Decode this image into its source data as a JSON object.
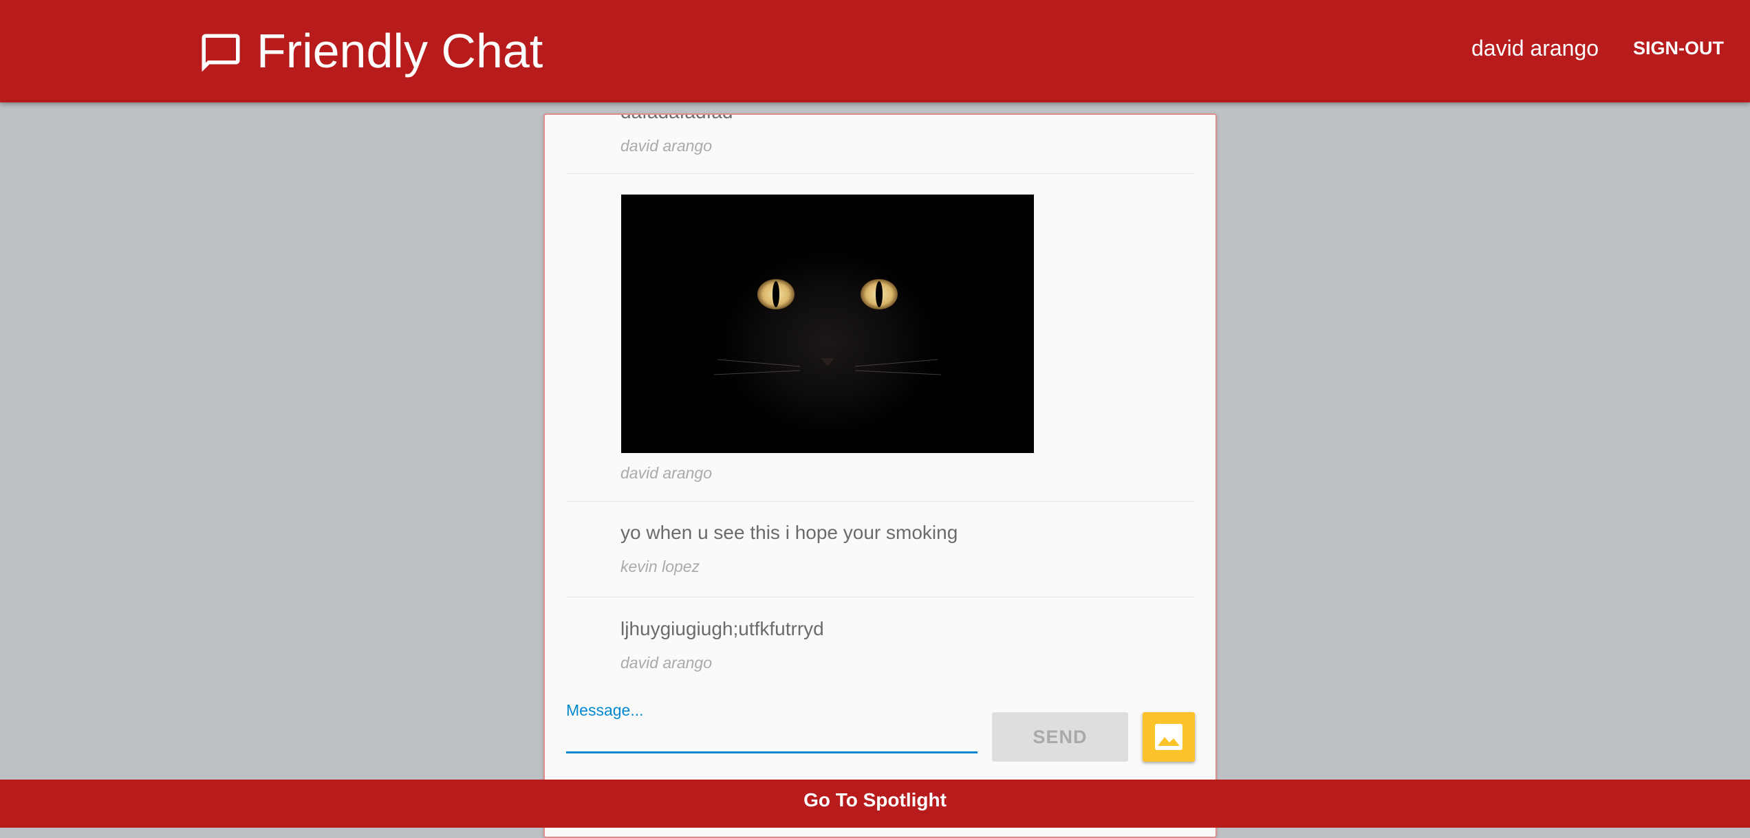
{
  "header": {
    "logo_icon": "chat-bubble-icon",
    "title": "Friendly Chat",
    "user_name": "david arango",
    "sign_out_label": "SIGN-OUT"
  },
  "messages": [
    {
      "text": "dafadafadfad",
      "author": "david arango"
    },
    {
      "image": "black cat photo",
      "author": "david arango"
    },
    {
      "text": "yo when u see this i hope your smoking",
      "author": "kevin lopez"
    },
    {
      "text": "ljhuygiugiugh;utfkfutrryd",
      "author": "david arango"
    }
  ],
  "composer": {
    "label": "Message...",
    "value": "",
    "send_label": "SEND",
    "image_button_icon": "image-icon"
  },
  "footer": {
    "link_label": "Go To Spotlight"
  },
  "colors": {
    "primary": "#b71b1c",
    "background": "#bdc1c5",
    "accent": "#0288d1",
    "image_button": "#fbc22a"
  }
}
